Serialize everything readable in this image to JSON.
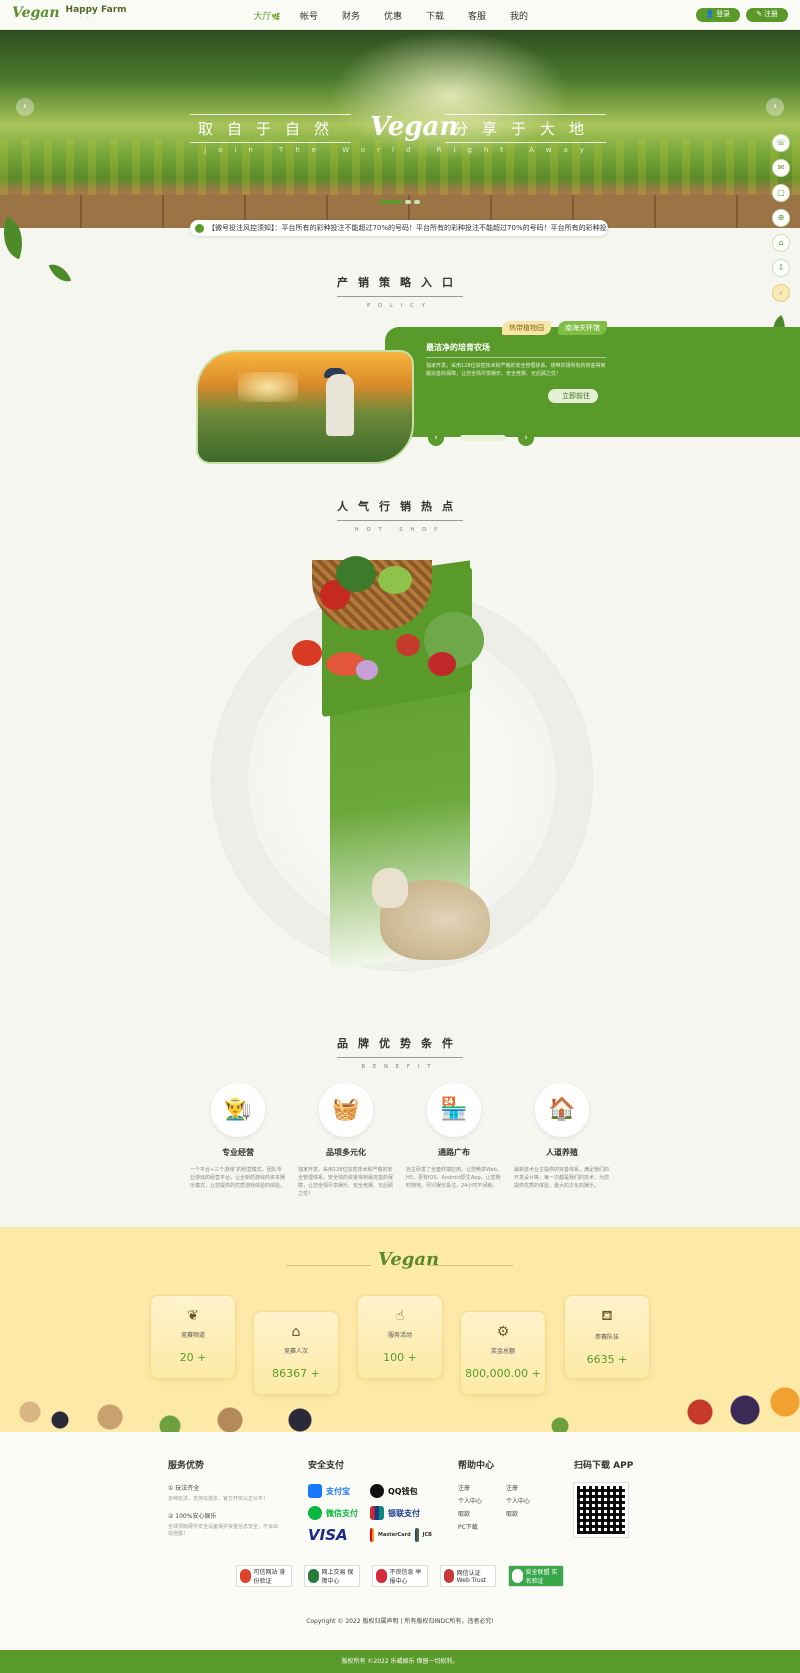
{
  "header": {
    "logo_mark": "Vegan",
    "logo_text": "Happy Farm",
    "logo_sub": "· · · · · · ·",
    "nav": [
      "大厅",
      "帐号",
      "财务",
      "优惠",
      "下载",
      "客服",
      "我的"
    ],
    "login": "登录",
    "register": "注册"
  },
  "banner": {
    "left_text": "取自于自然",
    "right_text": "分享于大地",
    "logo": "Vegan",
    "sub": "Join The World Right Away"
  },
  "notice": "【微号投注风控须知】：平台所有的彩种投注不能超过70%的号码！平台所有的彩种投注不能超过70%的号码！平台所有的彩种投注不能超过70%的",
  "policy": {
    "title": "产销策略入口",
    "sub": "POLICY",
    "tag1": "热带植物园",
    "tag2": "南海关怀馆",
    "heading": "最洁净的培育农场",
    "desc": "独家开发，采用128位加密技术和严格的安全管理体系，热带农场所有的资金得到最完善的保障，让您全情尽享娱乐、安全竞赛、无后顾之忧！",
    "button": "立即前往"
  },
  "hotshop": {
    "title": "人气行销热点",
    "sub": "HOT SHOP"
  },
  "benefit": {
    "title": "品牌优势条件",
    "sub": "BENEFIT",
    "items": [
      {
        "icon": "farmer-icon",
        "title": "专业经营",
        "desc": "一个平台+三个游戏“的经营模式，团队专业游戏的经营平台，让全新的游戏的资本娱乐模式，让您提供的优质游戏体验的体验。"
      },
      {
        "icon": "crate-icon",
        "title": "品项多元化",
        "desc": "独家开发，采用128位加密技术和严格的安全管理体系，安全快的资金得到最完善的保障，让您全情尽享娱乐、安全竞赛、无后顾之忧！"
      },
      {
        "icon": "market-icon",
        "title": "通路广布",
        "desc": "自主研发了全套终端应用，让您畅享Web、H5，更有IOS、Android原生App，让您随时随地，尽兴娱乐投注，24小时不间断。"
      },
      {
        "icon": "barn-icon",
        "title": "人道养殖",
        "desc": "最新技术业主提供的完善体系，满足我们的开发设计等，每一次都是我们的技术，为您提供优质的体验，最大的文化的娱乐。"
      }
    ]
  },
  "stats": {
    "logo": "Vegan",
    "cards": [
      {
        "icon": "sprout-icon",
        "label": "竞赛频道",
        "value": "20 +"
      },
      {
        "icon": "barn-icon",
        "label": "竞赛人次",
        "value": "86367 +"
      },
      {
        "icon": "hand-icon",
        "label": "服务活动",
        "value": "100 +"
      },
      {
        "icon": "tractor-icon",
        "label": "奖金总额",
        "value": "800,000.00 +"
      },
      {
        "icon": "milk-icon",
        "label": "参赛队伍",
        "value": "6635 +"
      }
    ]
  },
  "footer": {
    "service": {
      "title": "服务优势",
      "items": [
        {
          "title": "① 玩法齐全",
          "desc": "多种玩法，支持充值多，官方开奖公正公平！"
        },
        {
          "title": "② 100%安心娱乐",
          "desc": "全球顶级硬件安全设备保护资金信息安全，不会出现泄露！"
        }
      ]
    },
    "pay": {
      "title": "安全支付",
      "methods": [
        "支付宝",
        "QQ钱包",
        "微信支付",
        "银联支付",
        "VISA",
        "MasterCard",
        "JCB"
      ]
    },
    "help": {
      "title": "帮助中心",
      "links": [
        "注册",
        "注册",
        "个人中心",
        "个人中心",
        "取款",
        "取款",
        "PC下载"
      ]
    },
    "app": {
      "title": "扫码下载 APP"
    },
    "badges": [
      "可信网站 身份验证",
      "网上交易 保障中心",
      "不良信息 举报中心",
      "网信认证 Web Trust",
      "安全联盟 实名验证"
    ],
    "copyright": "Copyright © 2022 版权归属声明 | 所有版权归INDC所有，违者必究!",
    "bottom": "版权所有 ©2022 乐威娱乐 保留一切权利。"
  },
  "colors": {
    "primary": "#5a9a2a",
    "accent_yellow": "#fde9a8",
    "bg": "#f6f6f1"
  }
}
